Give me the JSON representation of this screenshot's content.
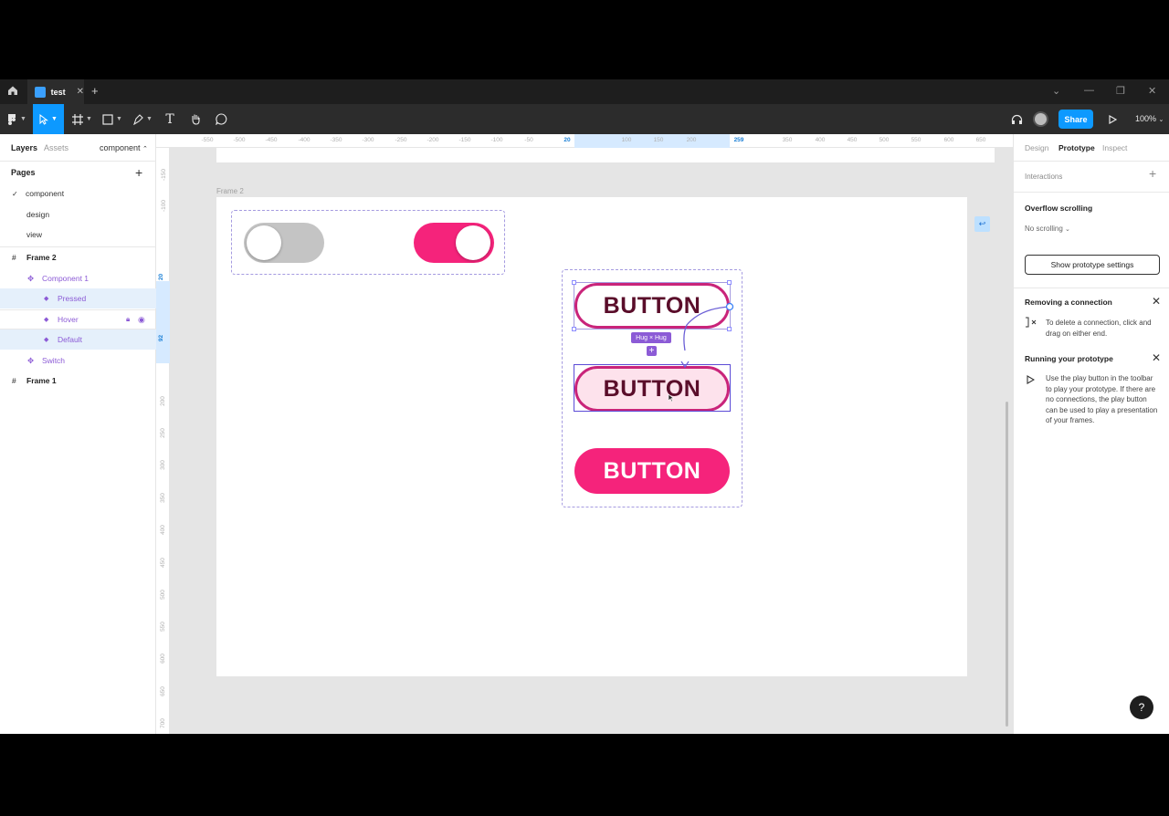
{
  "titlebar": {
    "file_name": "test",
    "close_glyph": "✕",
    "new_tab_glyph": "+",
    "window_controls": [
      "⌄",
      "—",
      "❐",
      "✕"
    ]
  },
  "toolbar": {
    "share_label": "Share",
    "zoom_label": "100%",
    "tools": [
      "main-menu-icon",
      "move-tool-icon",
      "frame-tool-icon",
      "shape-tool-icon",
      "pen-tool-icon",
      "text-tool-icon",
      "hand-tool-icon",
      "comment-tool-icon"
    ],
    "text_tool_glyph": "T"
  },
  "left_panel": {
    "tabs": [
      "Layers",
      "Assets"
    ],
    "page_selector": "component",
    "pages_title": "Pages",
    "add_glyph": "+",
    "pages": [
      {
        "label": "component",
        "check": "✓"
      },
      {
        "label": "design"
      },
      {
        "label": "view"
      }
    ],
    "layers": [
      {
        "label": "Frame 2"
      },
      {
        "label": "Component 1"
      },
      {
        "label": "Pressed"
      },
      {
        "label": "Hover"
      },
      {
        "label": "Default"
      },
      {
        "label": "Switch"
      },
      {
        "label": "Frame 1"
      }
    ]
  },
  "rulers": {
    "h_ticks": [
      "-550",
      "-500",
      "-450",
      "-400",
      "-350",
      "-300",
      "-250",
      "-200",
      "-150",
      "-100",
      "-50",
      "20",
      "100",
      "150",
      "200",
      "259",
      "350",
      "400",
      "450",
      "500",
      "550",
      "600",
      "650"
    ],
    "v_ticks": [
      "-150",
      "-100",
      "20",
      "92",
      "200",
      "250",
      "300",
      "350",
      "400",
      "450",
      "500",
      "550",
      "600",
      "650",
      "700"
    ]
  },
  "canvas": {
    "frame_label": "Frame 2",
    "buttons": [
      {
        "label": "BUTTON",
        "state": "outlined"
      },
      {
        "label": "BUTTON",
        "state": "light-pink"
      },
      {
        "label": "BUTTON",
        "state": "filled"
      }
    ],
    "hug_label": "Hug × Hug",
    "plus_glyph": "+",
    "back_glyph": "↩",
    "colors": {
      "accent_pink": "#f5237b",
      "switch_off": "#c4c4c4",
      "button_border": "#c9247a",
      "button_light_bg": "#fde2ec",
      "button_text_dark": "#5a0d2a",
      "selection": "#8c5bd6"
    }
  },
  "right_panel": {
    "tabs": [
      "Design",
      "Prototype",
      "Inspect"
    ],
    "interactions_label": "Interactions",
    "add_glyph": "+",
    "overflow_title": "Overflow scrolling",
    "overflow_value": "No scrolling",
    "show_settings_label": "Show prototype settings",
    "close_glyph": "✕",
    "removing_title": "Removing a connection",
    "removing_text": "To delete a connection, click and drag on either end.",
    "running_title": "Running your prototype",
    "running_text": "Use the play button in the toolbar to play your prototype. If there are no connections, the play button can be used to play a presentation of your frames.",
    "help_glyph": "?"
  }
}
